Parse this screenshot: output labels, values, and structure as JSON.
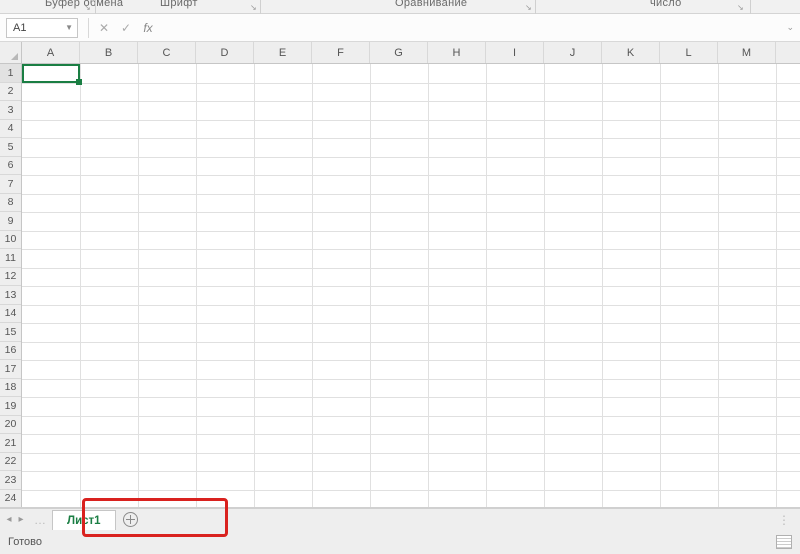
{
  "ribbon": {
    "groups": [
      "Буфер обмена",
      "Шрифт",
      "Оравнивание",
      "число"
    ]
  },
  "formula_bar": {
    "namebox_value": "A1",
    "cancel": "✕",
    "confirm": "✓",
    "fx": "fx",
    "formula_value": ""
  },
  "grid": {
    "columns": [
      "A",
      "B",
      "C",
      "D",
      "E",
      "F",
      "G",
      "H",
      "I",
      "J",
      "K",
      "L",
      "M"
    ],
    "rows": [
      "1",
      "2",
      "3",
      "4",
      "5",
      "6",
      "7",
      "8",
      "9",
      "10",
      "11",
      "12",
      "13",
      "14",
      "15",
      "16",
      "17",
      "18",
      "19",
      "20",
      "21",
      "22",
      "23",
      "24"
    ],
    "active_cell": "A1"
  },
  "sheets": {
    "active_tab": "Лист1",
    "nav_prev": "◂",
    "nav_next": "▸",
    "ellipsis": "…"
  },
  "status": {
    "text": "Готово"
  }
}
